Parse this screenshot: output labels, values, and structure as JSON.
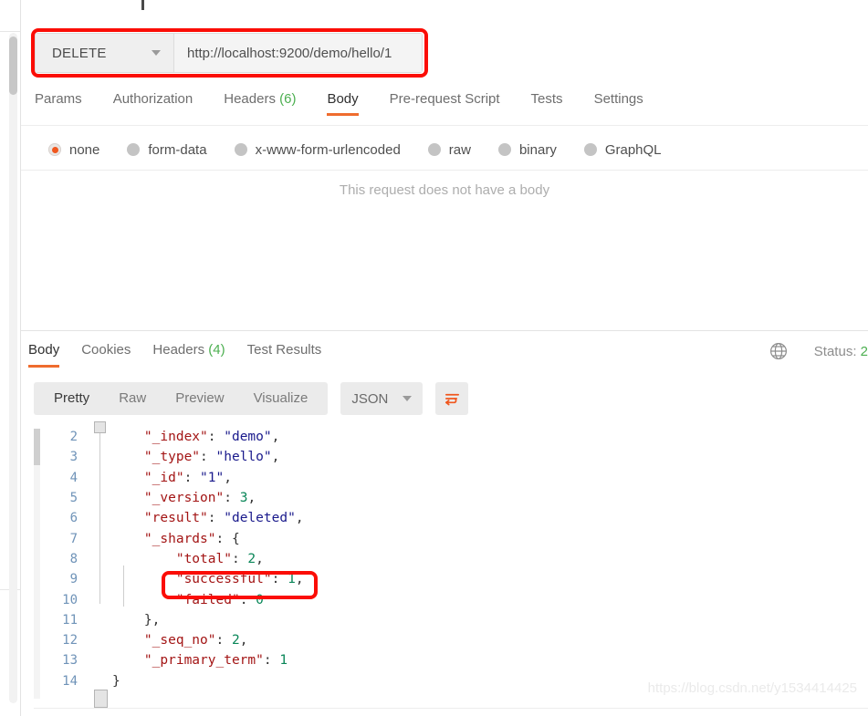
{
  "request": {
    "method": "DELETE",
    "url": "http://localhost:9200/demo/hello/1",
    "tabs": [
      {
        "label": "Params",
        "count": "",
        "active": false
      },
      {
        "label": "Authorization",
        "count": "",
        "active": false
      },
      {
        "label": "Headers",
        "count": "(6)",
        "active": false
      },
      {
        "label": "Body",
        "count": "",
        "active": true
      },
      {
        "label": "Pre-request Script",
        "count": "",
        "active": false
      },
      {
        "label": "Tests",
        "count": "",
        "active": false
      },
      {
        "label": "Settings",
        "count": "",
        "active": false
      }
    ],
    "body_types": [
      {
        "label": "none",
        "selected": true
      },
      {
        "label": "form-data",
        "selected": false
      },
      {
        "label": "x-www-form-urlencoded",
        "selected": false
      },
      {
        "label": "raw",
        "selected": false
      },
      {
        "label": "binary",
        "selected": false
      },
      {
        "label": "GraphQL",
        "selected": false
      }
    ],
    "empty_body_text": "This request does not have a body"
  },
  "response": {
    "tabs": [
      {
        "label": "Body",
        "count": "",
        "active": true
      },
      {
        "label": "Cookies",
        "count": "",
        "active": false
      },
      {
        "label": "Headers",
        "count": "(4)",
        "active": false
      },
      {
        "label": "Test Results",
        "count": "",
        "active": false
      }
    ],
    "status_prefix": "Status: ",
    "status_code": "2",
    "globe_icon": "globe-icon",
    "view_modes": [
      {
        "label": "Pretty",
        "active": true
      },
      {
        "label": "Raw",
        "active": false
      },
      {
        "label": "Preview",
        "active": false
      },
      {
        "label": "Visualize",
        "active": false
      }
    ],
    "format": "JSON",
    "wrap_icon": "word-wrap-icon",
    "code_lines": [
      {
        "no": "2",
        "indent": 4,
        "tokens": [
          {
            "t": "\"_index\"",
            "c": "k"
          },
          {
            "t": ": ",
            "c": "p"
          },
          {
            "t": "\"demo\"",
            "c": "s"
          },
          {
            "t": ",",
            "c": "p"
          }
        ]
      },
      {
        "no": "3",
        "indent": 4,
        "tokens": [
          {
            "t": "\"_type\"",
            "c": "k"
          },
          {
            "t": ": ",
            "c": "p"
          },
          {
            "t": "\"hello\"",
            "c": "s"
          },
          {
            "t": ",",
            "c": "p"
          }
        ]
      },
      {
        "no": "4",
        "indent": 4,
        "tokens": [
          {
            "t": "\"_id\"",
            "c": "k"
          },
          {
            "t": ": ",
            "c": "p"
          },
          {
            "t": "\"1\"",
            "c": "s"
          },
          {
            "t": ",",
            "c": "p"
          }
        ]
      },
      {
        "no": "5",
        "indent": 4,
        "tokens": [
          {
            "t": "\"_version\"",
            "c": "k"
          },
          {
            "t": ": ",
            "c": "p"
          },
          {
            "t": "3",
            "c": "n"
          },
          {
            "t": ",",
            "c": "p"
          }
        ]
      },
      {
        "no": "6",
        "indent": 4,
        "tokens": [
          {
            "t": "\"result\"",
            "c": "k"
          },
          {
            "t": ": ",
            "c": "p"
          },
          {
            "t": "\"deleted\"",
            "c": "s"
          },
          {
            "t": ",",
            "c": "p"
          }
        ]
      },
      {
        "no": "7",
        "indent": 4,
        "tokens": [
          {
            "t": "\"_shards\"",
            "c": "k"
          },
          {
            "t": ": {",
            "c": "p"
          }
        ]
      },
      {
        "no": "8",
        "indent": 8,
        "tokens": [
          {
            "t": "\"total\"",
            "c": "k"
          },
          {
            "t": ": ",
            "c": "p"
          },
          {
            "t": "2",
            "c": "n"
          },
          {
            "t": ",",
            "c": "p"
          }
        ]
      },
      {
        "no": "9",
        "indent": 8,
        "tokens": [
          {
            "t": "\"successful\"",
            "c": "k"
          },
          {
            "t": ": ",
            "c": "p"
          },
          {
            "t": "1",
            "c": "n"
          },
          {
            "t": ",",
            "c": "p"
          }
        ]
      },
      {
        "no": "10",
        "indent": 8,
        "tokens": [
          {
            "t": "\"failed\"",
            "c": "k"
          },
          {
            "t": ": ",
            "c": "p"
          },
          {
            "t": "0",
            "c": "n"
          }
        ]
      },
      {
        "no": "11",
        "indent": 4,
        "tokens": [
          {
            "t": "},",
            "c": "p"
          }
        ]
      },
      {
        "no": "12",
        "indent": 4,
        "tokens": [
          {
            "t": "\"_seq_no\"",
            "c": "k"
          },
          {
            "t": ": ",
            "c": "p"
          },
          {
            "t": "2",
            "c": "n"
          },
          {
            "t": ",",
            "c": "p"
          }
        ]
      },
      {
        "no": "13",
        "indent": 4,
        "tokens": [
          {
            "t": "\"_primary_term\"",
            "c": "k"
          },
          {
            "t": ": ",
            "c": "p"
          },
          {
            "t": "1",
            "c": "n"
          }
        ]
      },
      {
        "no": "14",
        "indent": 0,
        "tokens": [
          {
            "t": "}",
            "c": "p"
          }
        ]
      }
    ]
  },
  "annotations": {
    "url_box_color": "#fb0d06",
    "successful_box_color": "#fb0d06"
  },
  "watermark": "https://blog.csdn.net/y1534414425"
}
